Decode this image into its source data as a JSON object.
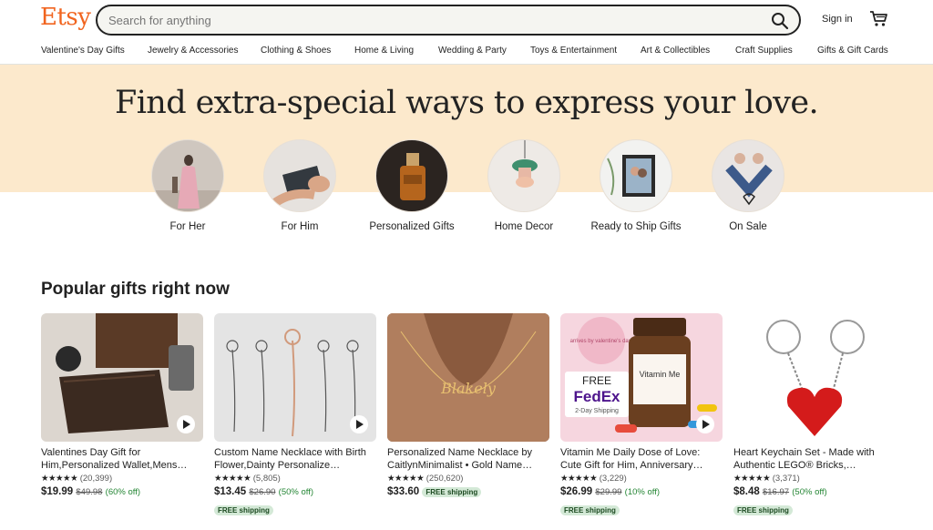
{
  "header": {
    "logo": "Etsy",
    "search_placeholder": "Search for anything",
    "signin_label": "Sign in"
  },
  "nav": [
    "Valentine's Day Gifts",
    "Jewelry & Accessories",
    "Clothing & Shoes",
    "Home & Living",
    "Wedding & Party",
    "Toys & Entertainment",
    "Art & Collectibles",
    "Craft Supplies",
    "Gifts & Gift Cards"
  ],
  "hero": {
    "title": "Find extra-special ways to express your love.",
    "categories": [
      {
        "label": "For Her"
      },
      {
        "label": "For Him"
      },
      {
        "label": "Personalized Gifts"
      },
      {
        "label": "Home Decor"
      },
      {
        "label": "Ready to Ship Gifts"
      },
      {
        "label": "On Sale"
      }
    ]
  },
  "popular": {
    "title": "Popular gifts right now",
    "items": [
      {
        "title": "Valentines Day Gift for Him,Personalized Wallet,Mens…",
        "stars": "★★★★★",
        "reviews": "(20,399)",
        "price": "$19.99",
        "original": "$49.98",
        "discount": "(60% off)",
        "free_shipping": "",
        "video": true
      },
      {
        "title": "Custom Name Necklace with Birth Flower,Dainty Personalize…",
        "stars": "★★★★★",
        "reviews": "(5,805)",
        "price": "$13.45",
        "original": "$26.90",
        "discount": "(50% off)",
        "free_shipping": "FREE shipping",
        "video": true
      },
      {
        "title": "Personalized Name Necklace by CaitlynMinimalist • Gold Name…",
        "stars": "★★★★★",
        "reviews": "(250,620)",
        "price": "$33.60",
        "original": "",
        "discount": "",
        "inline_shipping": "FREE shipping",
        "free_shipping": "",
        "video": false
      },
      {
        "title": "Vitamin Me Daily Dose of Love: Cute Gift for Him, Anniversary…",
        "stars": "★★★★★",
        "reviews": "(3,229)",
        "price": "$26.99",
        "original": "$29.99",
        "discount": "(10% off)",
        "free_shipping": "FREE shipping",
        "video": true
      },
      {
        "title": "Heart Keychain Set - Made with Authentic LEGO® Bricks,…",
        "stars": "★★★★★",
        "reviews": "(3,371)",
        "price": "$8.48",
        "original": "$16.97",
        "discount": "(50% off)",
        "free_shipping": "FREE shipping",
        "video": false
      }
    ]
  },
  "image_text": {
    "fedex_free": "FREE",
    "fedex_brand": "FedEx",
    "fedex_sub": "2-Day Shipping",
    "vitamin_label": "Vitamin Me",
    "bubble": "arrives by valentine's day!",
    "necklace_name": "Blakely"
  },
  "colors": {
    "brand": "#f1641e",
    "hero_bg": "#fce9cc",
    "free_shipping_bg": "#d4e9d7",
    "discount": "#258635"
  }
}
